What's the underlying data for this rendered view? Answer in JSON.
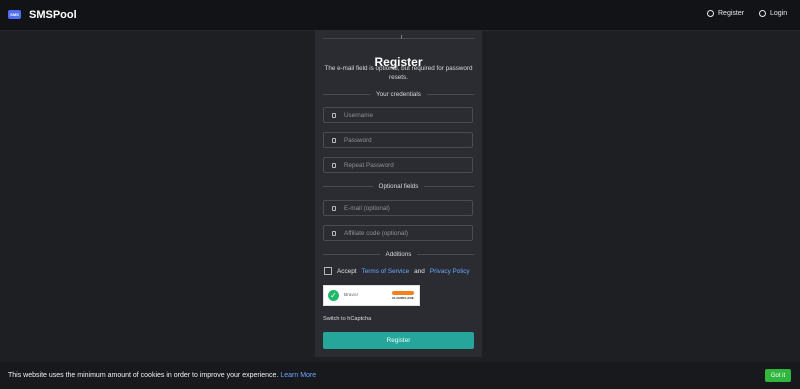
{
  "header": {
    "logo_text": "SMS",
    "brand": "SMSPool",
    "nav": [
      {
        "label": "Register",
        "icon": "register-icon"
      },
      {
        "label": "Login",
        "icon": "login-icon"
      }
    ]
  },
  "form": {
    "title": "Register",
    "subtitle": "The e-mail field is optional, but required for password resets.",
    "sections": {
      "credentials": "Your credentials",
      "optional": "Optional fields",
      "additions": "Additions"
    },
    "fields": {
      "username": {
        "placeholder": "Username",
        "value": ""
      },
      "password": {
        "placeholder": "Password",
        "value": ""
      },
      "repeat_password": {
        "placeholder": "Repeat Password",
        "value": ""
      },
      "email": {
        "placeholder": "E-mail (optional)",
        "value": ""
      },
      "affiliate_code": {
        "placeholder": "Affiliate code (optional)",
        "value": ""
      }
    },
    "accept": {
      "prefix": "Accept",
      "terms": "Terms of Service",
      "and": "and",
      "privacy": "Privacy Policy",
      "checked": false
    },
    "captcha": {
      "status": "Bravo!",
      "provider": "CLOUDFLARE",
      "status_color": "#20b96a"
    },
    "switch_captcha": "Switch to hCaptcha",
    "submit_label": "Register"
  },
  "cookie_banner": {
    "text": "This website uses the minimum amount of cookies in order to improve your experience.",
    "learn_more": "Learn More",
    "button": "Got it"
  },
  "colors": {
    "accent": "#26a69a",
    "link": "#6ba7ff",
    "cookie_button": "#31b63e"
  }
}
